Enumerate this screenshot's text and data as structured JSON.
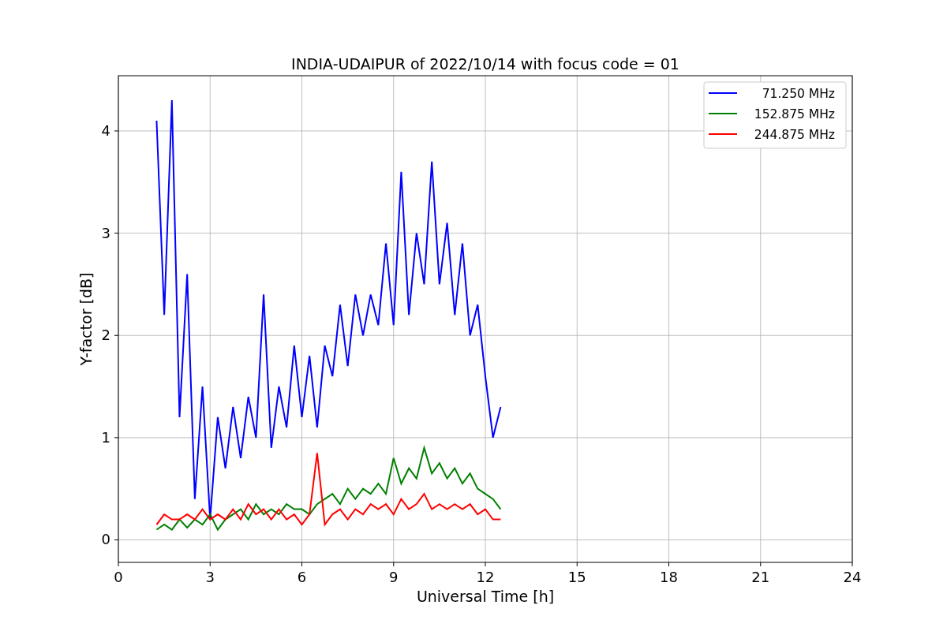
{
  "chart_data": {
    "type": "line",
    "title": "INDIA-UDAIPUR of 2022/10/14 with focus code = 01",
    "xlabel": "Universal Time [h]",
    "ylabel": "Y-factor [dB]",
    "x": [
      1.25,
      1.5,
      1.75,
      2.0,
      2.25,
      2.5,
      2.75,
      3.0,
      3.25,
      3.5,
      3.75,
      4.0,
      4.25,
      4.5,
      4.75,
      5.0,
      5.25,
      5.5,
      5.75,
      6.0,
      6.25,
      6.5,
      6.75,
      7.0,
      7.25,
      7.5,
      7.75,
      8.0,
      8.25,
      8.5,
      8.75,
      9.0,
      9.25,
      9.5,
      9.75,
      10.0,
      10.25,
      10.5,
      10.75,
      11.0,
      11.25,
      11.5,
      11.75,
      12.0,
      12.25,
      12.5
    ],
    "series": [
      {
        "name": "71.250 MHz",
        "color": "#0000ff",
        "values": [
          4.1,
          2.2,
          4.3,
          1.2,
          2.6,
          0.4,
          1.5,
          0.2,
          1.2,
          0.7,
          1.3,
          0.8,
          1.4,
          1.0,
          2.4,
          0.9,
          1.5,
          1.1,
          1.9,
          1.2,
          1.8,
          1.1,
          1.9,
          1.6,
          2.3,
          1.7,
          2.4,
          2.0,
          2.4,
          2.1,
          2.9,
          2.1,
          3.6,
          2.2,
          3.0,
          2.5,
          3.7,
          2.5,
          3.1,
          2.2,
          2.9,
          2.0,
          2.3,
          1.6,
          1.0,
          1.3
        ]
      },
      {
        "name": "152.875 MHz",
        "color": "#008000",
        "values": [
          0.1,
          0.15,
          0.1,
          0.2,
          0.12,
          0.2,
          0.15,
          0.25,
          0.1,
          0.2,
          0.25,
          0.3,
          0.2,
          0.35,
          0.25,
          0.3,
          0.25,
          0.35,
          0.3,
          0.3,
          0.25,
          0.35,
          0.4,
          0.45,
          0.35,
          0.5,
          0.4,
          0.5,
          0.45,
          0.55,
          0.45,
          0.8,
          0.55,
          0.7,
          0.6,
          0.9,
          0.65,
          0.75,
          0.6,
          0.7,
          0.55,
          0.65,
          0.5,
          0.45,
          0.4,
          0.3
        ]
      },
      {
        "name": "244.875 MHz",
        "color": "#ff0000",
        "values": [
          0.15,
          0.25,
          0.2,
          0.2,
          0.25,
          0.2,
          0.3,
          0.2,
          0.25,
          0.2,
          0.3,
          0.2,
          0.35,
          0.25,
          0.3,
          0.2,
          0.3,
          0.2,
          0.25,
          0.15,
          0.25,
          0.85,
          0.15,
          0.25,
          0.3,
          0.2,
          0.3,
          0.25,
          0.35,
          0.3,
          0.35,
          0.25,
          0.4,
          0.3,
          0.35,
          0.45,
          0.3,
          0.35,
          0.3,
          0.35,
          0.3,
          0.35,
          0.25,
          0.3,
          0.2,
          0.2
        ]
      }
    ],
    "grid": true,
    "legend": "upper right",
    "xlim": [
      0,
      24
    ],
    "ylim": [
      -0.22,
      4.54
    ],
    "xticks": [
      0,
      3,
      6,
      9,
      12,
      15,
      18,
      21,
      24
    ],
    "yticks": [
      0,
      1,
      2,
      3,
      4
    ]
  }
}
